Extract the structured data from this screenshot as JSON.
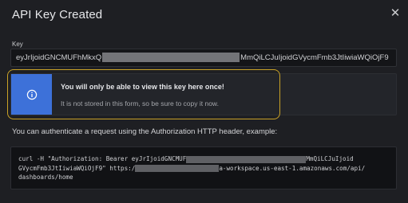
{
  "dialog": {
    "title": "API Key Created",
    "close_icon": "close-icon"
  },
  "key": {
    "label": "Key",
    "value_prefix": "eyJrIjoidGNCMUFhMkxQ",
    "value_suffix": "MmQiLCJuIjoidGVycmFmb3JtIiwiaWQiOjF9"
  },
  "alert": {
    "icon": "info-icon",
    "title": "You will only be able to view this key here once!",
    "description": "It is not stored in this form, so be sure to copy it now."
  },
  "auth": {
    "text": "You can authenticate a request using the Authorization HTTP header, example:"
  },
  "code": {
    "line1_start": "curl -H \"Authorization: Bearer eyJrIjoidGNCMUF",
    "line1_end": "MmQiLCJuIjoid",
    "line2_start": "GVycmFmb3JtIiwiaWQiOjF9\" https:/",
    "line2_end": "a-workspace.us-east-1.amazonaws.com/api/",
    "line3": "dashboards/home"
  },
  "colors": {
    "accent_blue": "#3d71d9",
    "highlight_outline": "#c9a227",
    "background": "#1e1f23"
  }
}
